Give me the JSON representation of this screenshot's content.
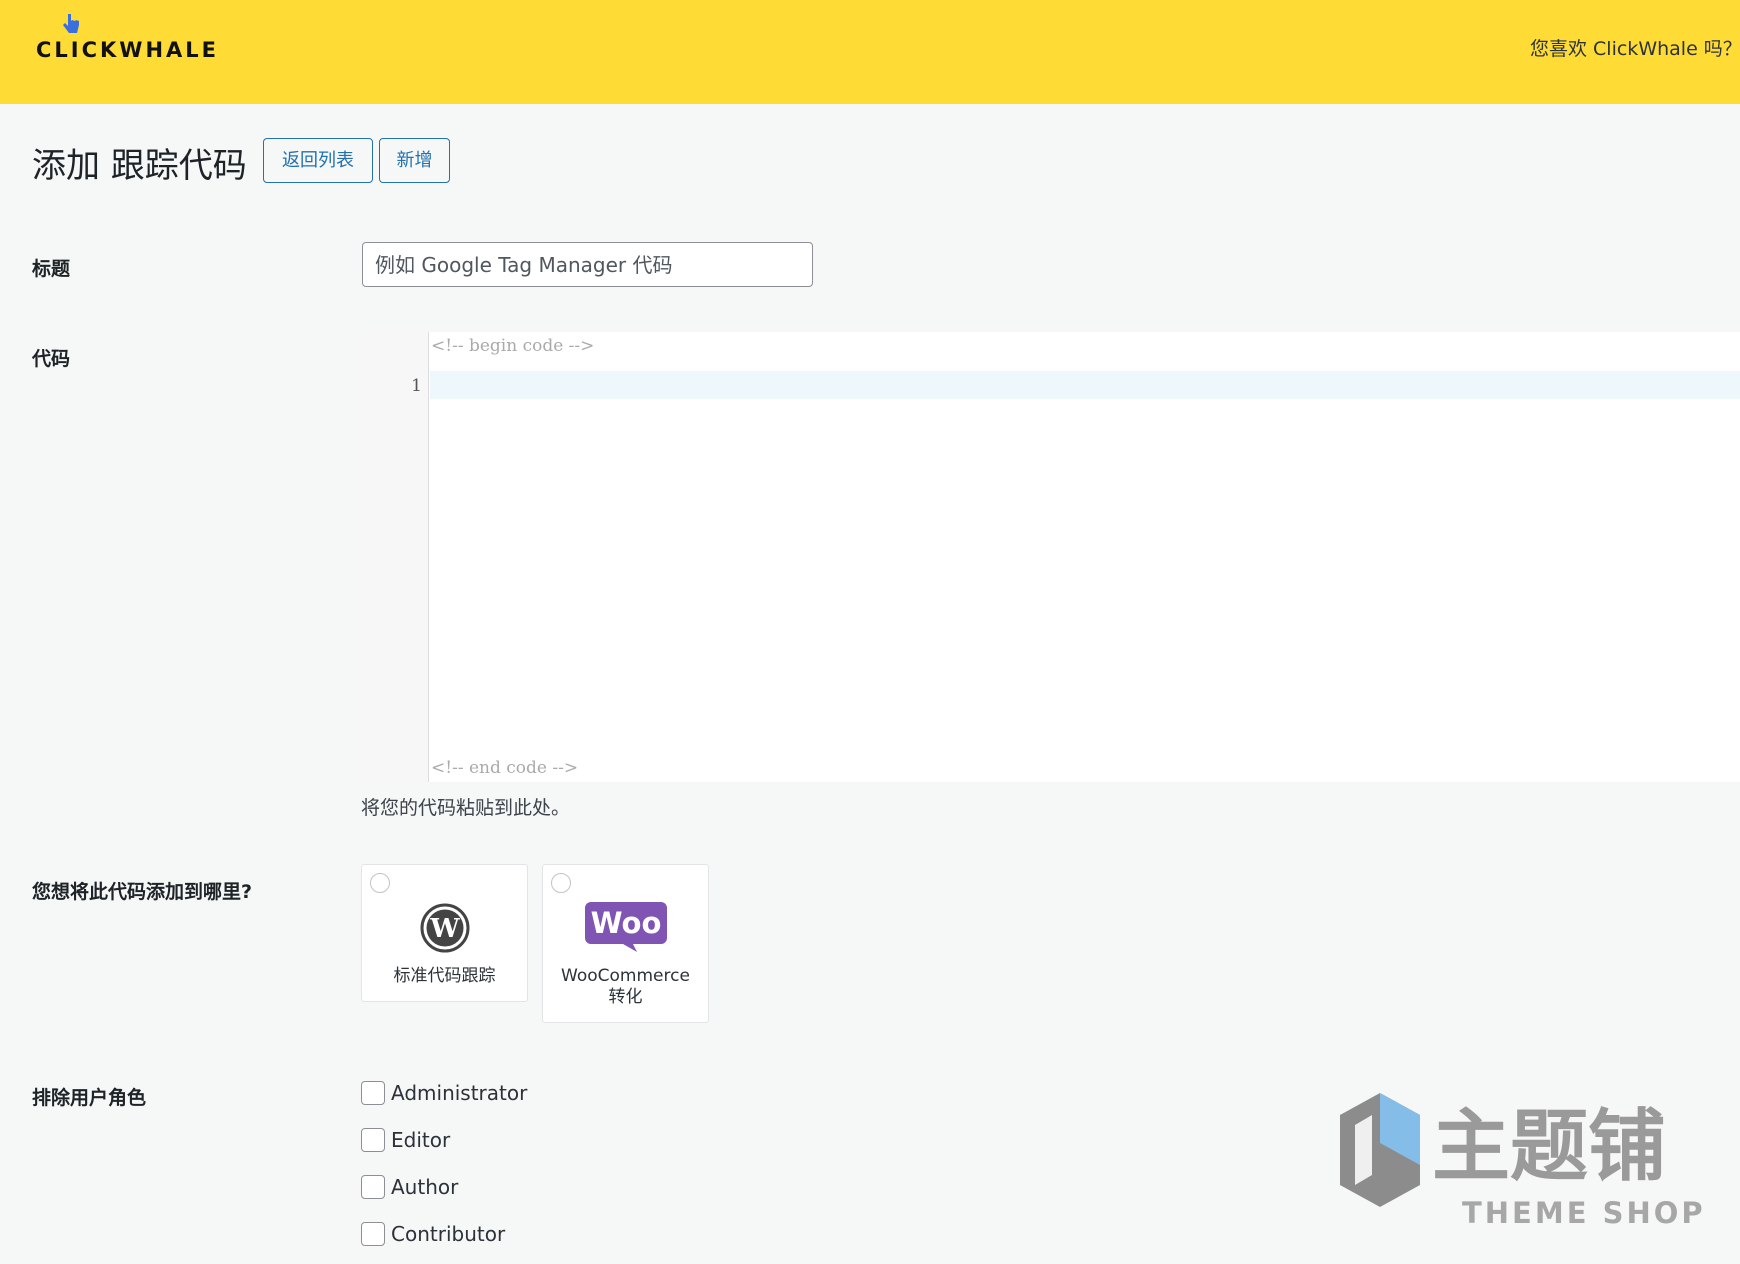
{
  "header": {
    "logo_text": "CLICKWHALE",
    "promo_text": "您喜欢 ClickWhale 吗？请"
  },
  "page": {
    "title": "添加 跟踪代码",
    "back_button": "返回列表",
    "new_button": "新增"
  },
  "form": {
    "title_label": "标题",
    "title_placeholder": "例如 Google Tag Manager 代码",
    "code_label": "代码",
    "code_begin": "<!-- begin code -->",
    "code_end": "<!-- end code -->",
    "line_number": "1",
    "code_help": "将您的代码粘贴到此处。",
    "location_label": "您想将此代码添加到哪里?",
    "locations": [
      {
        "label": "标准代码跟踪",
        "icon": "wordpress-icon"
      },
      {
        "label_line1": "WooCommerce",
        "label_line2": "转化",
        "icon": "woo-icon"
      }
    ],
    "exclude_label": "排除用户角色",
    "roles": [
      "Administrator",
      "Editor",
      "Author",
      "Contributor"
    ]
  },
  "watermark": {
    "text_cn": "主题铺",
    "text_en": "THEME SHOP"
  },
  "colors": {
    "topbar": "#ffdb36",
    "accent": "#2271b1",
    "woo_purple": "#7f54b3"
  }
}
